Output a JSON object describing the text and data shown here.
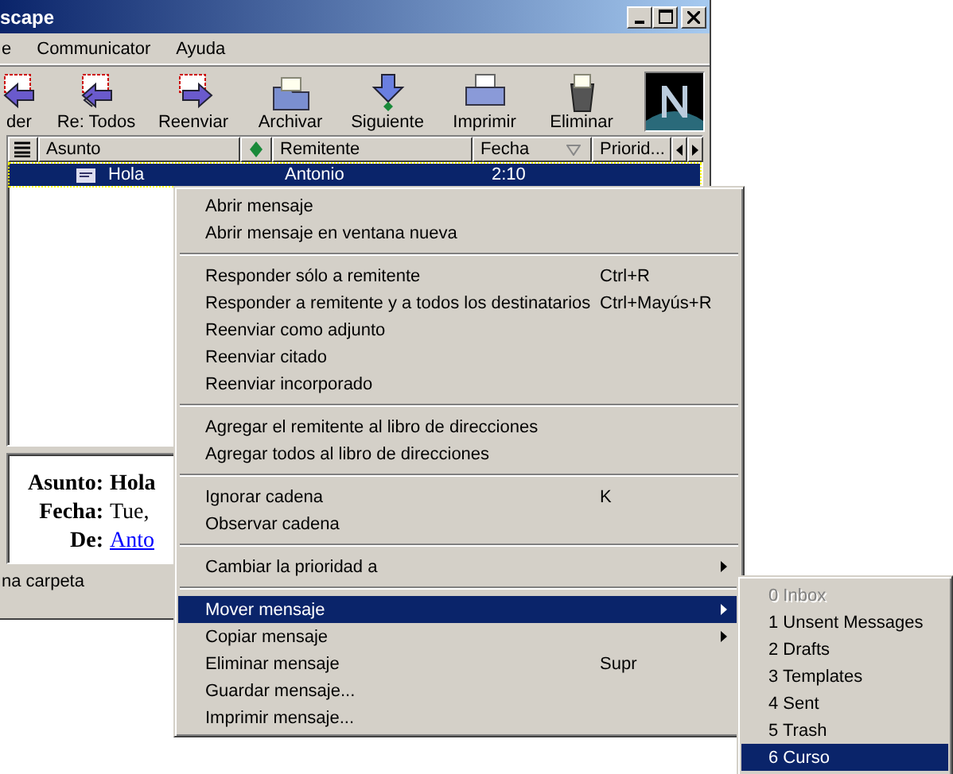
{
  "window": {
    "title": "scape"
  },
  "menubar": [
    {
      "label": "e"
    },
    {
      "label": "Communicator"
    },
    {
      "label": "Ayuda"
    }
  ],
  "toolbar": [
    {
      "label": "der",
      "kind": "reply"
    },
    {
      "label": "Re: Todos",
      "kind": "reply_all"
    },
    {
      "label": "Reenviar",
      "kind": "forward"
    },
    {
      "label": "Archivar",
      "kind": "file"
    },
    {
      "label": "Siguiente",
      "kind": "next"
    },
    {
      "label": "Imprimir",
      "kind": "print"
    },
    {
      "label": "Eliminar",
      "kind": "delete"
    }
  ],
  "message_list": {
    "columns": [
      {
        "label": "Asunto"
      },
      {
        "label": "Remitente"
      },
      {
        "label": "Fecha"
      },
      {
        "label": "Priorid..."
      }
    ],
    "rows": [
      {
        "subject": "Hola",
        "sender": "Antonio",
        "date": "2:10",
        "selected": true
      }
    ]
  },
  "preview": {
    "fields": [
      {
        "label": "Asunto:",
        "value": "Hola",
        "kind": "bold"
      },
      {
        "label": "Fecha:",
        "value": "Tue,",
        "kind": "text"
      },
      {
        "label": "De:",
        "value": "Anto",
        "kind": "link"
      }
    ]
  },
  "status_bar": "na carpeta",
  "context_menu": {
    "items": [
      {
        "kind": "item",
        "label": "Abrir mensaje",
        "selected": false
      },
      {
        "kind": "item",
        "label": "Abrir mensaje en ventana nueva",
        "selected": false
      },
      {
        "kind": "separator"
      },
      {
        "kind": "item",
        "label": "Responder sólo a remitente",
        "shortcut": "Ctrl+R",
        "selected": false
      },
      {
        "kind": "item",
        "label": "Responder a remitente y a todos los destinatarios",
        "shortcut": "Ctrl+Mayús+R",
        "selected": false
      },
      {
        "kind": "item",
        "label": "Reenviar como adjunto",
        "selected": false
      },
      {
        "kind": "item",
        "label": "Reenviar citado",
        "selected": false
      },
      {
        "kind": "item",
        "label": "Reenviar incorporado",
        "selected": false
      },
      {
        "kind": "separator"
      },
      {
        "kind": "item",
        "label": "Agregar el remitente al libro de direcciones",
        "selected": false
      },
      {
        "kind": "item",
        "label": "Agregar todos al libro de direcciones",
        "selected": false
      },
      {
        "kind": "separator"
      },
      {
        "kind": "item",
        "label": "Ignorar cadena",
        "shortcut": "K",
        "selected": false
      },
      {
        "kind": "item",
        "label": "Observar cadena",
        "selected": false
      },
      {
        "kind": "separator"
      },
      {
        "kind": "item",
        "label": "Cambiar la prioridad a",
        "submenu": true,
        "selected": false
      },
      {
        "kind": "separator"
      },
      {
        "kind": "item",
        "label": "Mover mensaje",
        "submenu": true,
        "selected": true
      },
      {
        "kind": "item",
        "label": "Copiar mensaje",
        "submenu": true,
        "selected": false
      },
      {
        "kind": "item",
        "label": "Eliminar mensaje",
        "shortcut": "Supr",
        "selected": false
      },
      {
        "kind": "item",
        "label": "Guardar mensaje...",
        "selected": false
      },
      {
        "kind": "item",
        "label": "Imprimir mensaje...",
        "selected": false
      }
    ]
  },
  "submenu": {
    "items": [
      {
        "label": "0 Inbox",
        "disabled": true,
        "selected": false
      },
      {
        "label": "1 Unsent Messages",
        "disabled": false,
        "selected": false
      },
      {
        "label": "2 Drafts",
        "disabled": false,
        "selected": false
      },
      {
        "label": "3 Templates",
        "disabled": false,
        "selected": false
      },
      {
        "label": "4 Sent",
        "disabled": false,
        "selected": false
      },
      {
        "label": "5 Trash",
        "disabled": false,
        "selected": false
      },
      {
        "label": "6 Curso",
        "disabled": false,
        "selected": true
      }
    ]
  }
}
